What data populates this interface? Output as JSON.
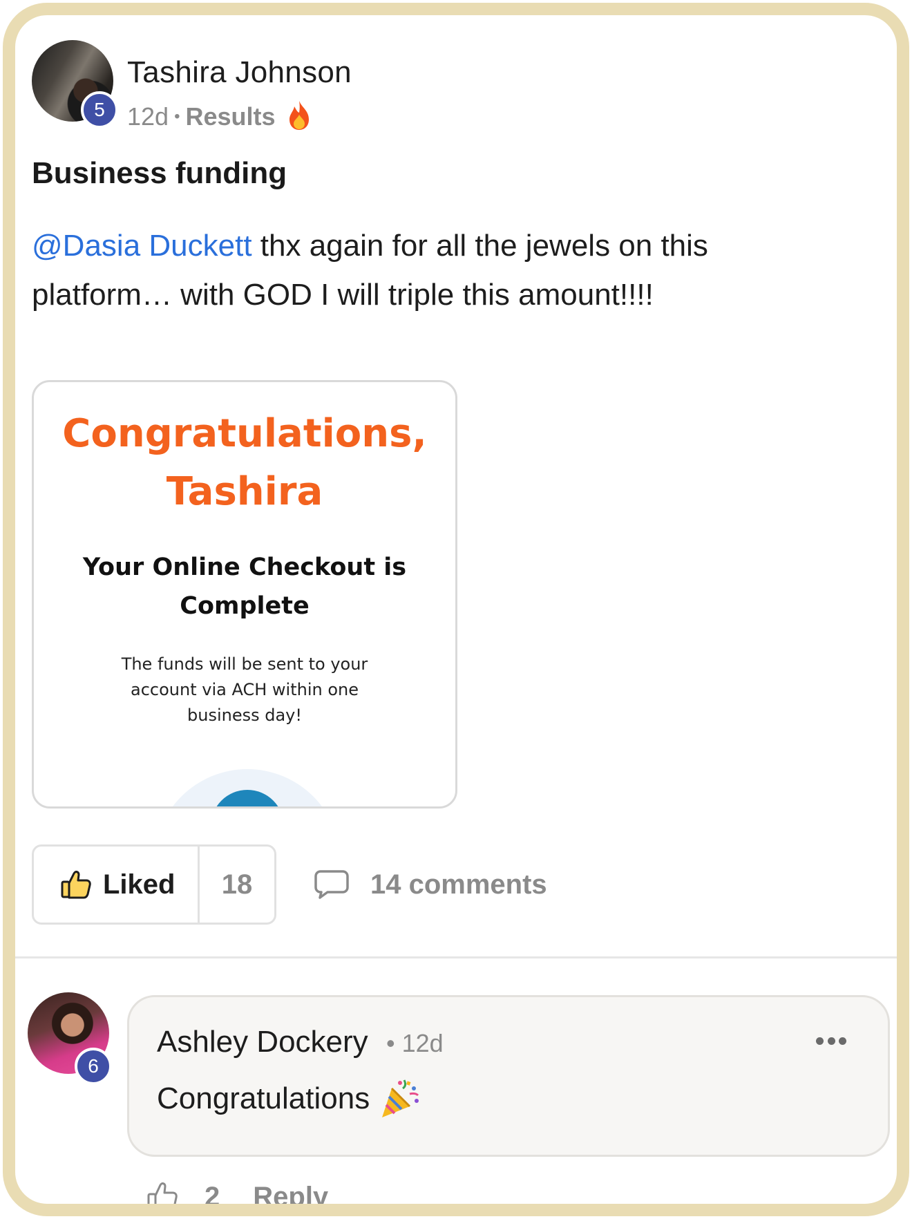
{
  "post": {
    "author": "Tashira Johnson",
    "author_level": "5",
    "time": "12d",
    "separator": "•",
    "category": "Results",
    "category_icon": "fire-icon",
    "title": "Business funding",
    "mention": "@Dasia Duckett",
    "body": " thx again for all the jewels on this platform… with GOD I will triple this amount!!!!",
    "attachment": {
      "headline_line1": "Congratulations,",
      "headline_line2": "Tashira",
      "subheading": "Your Online Checkout is Complete",
      "text": "The funds will be sent to your account via ACH within one business day!",
      "headline_color": "#f3621e"
    },
    "like_label": "Liked",
    "like_count": "18",
    "comments_label": "14 comments"
  },
  "comment": {
    "author": "Ashley Dockery",
    "author_level": "6",
    "time": "• 12d",
    "text": "Congratulations",
    "text_icon": "party-popper-icon",
    "like_count": "2",
    "reply_label": "Reply"
  },
  "colors": {
    "frame_border": "#e9dcb3",
    "badge": "#3f4fa6",
    "mention": "#2a6fdb",
    "muted_text": "#8a8a8a"
  }
}
